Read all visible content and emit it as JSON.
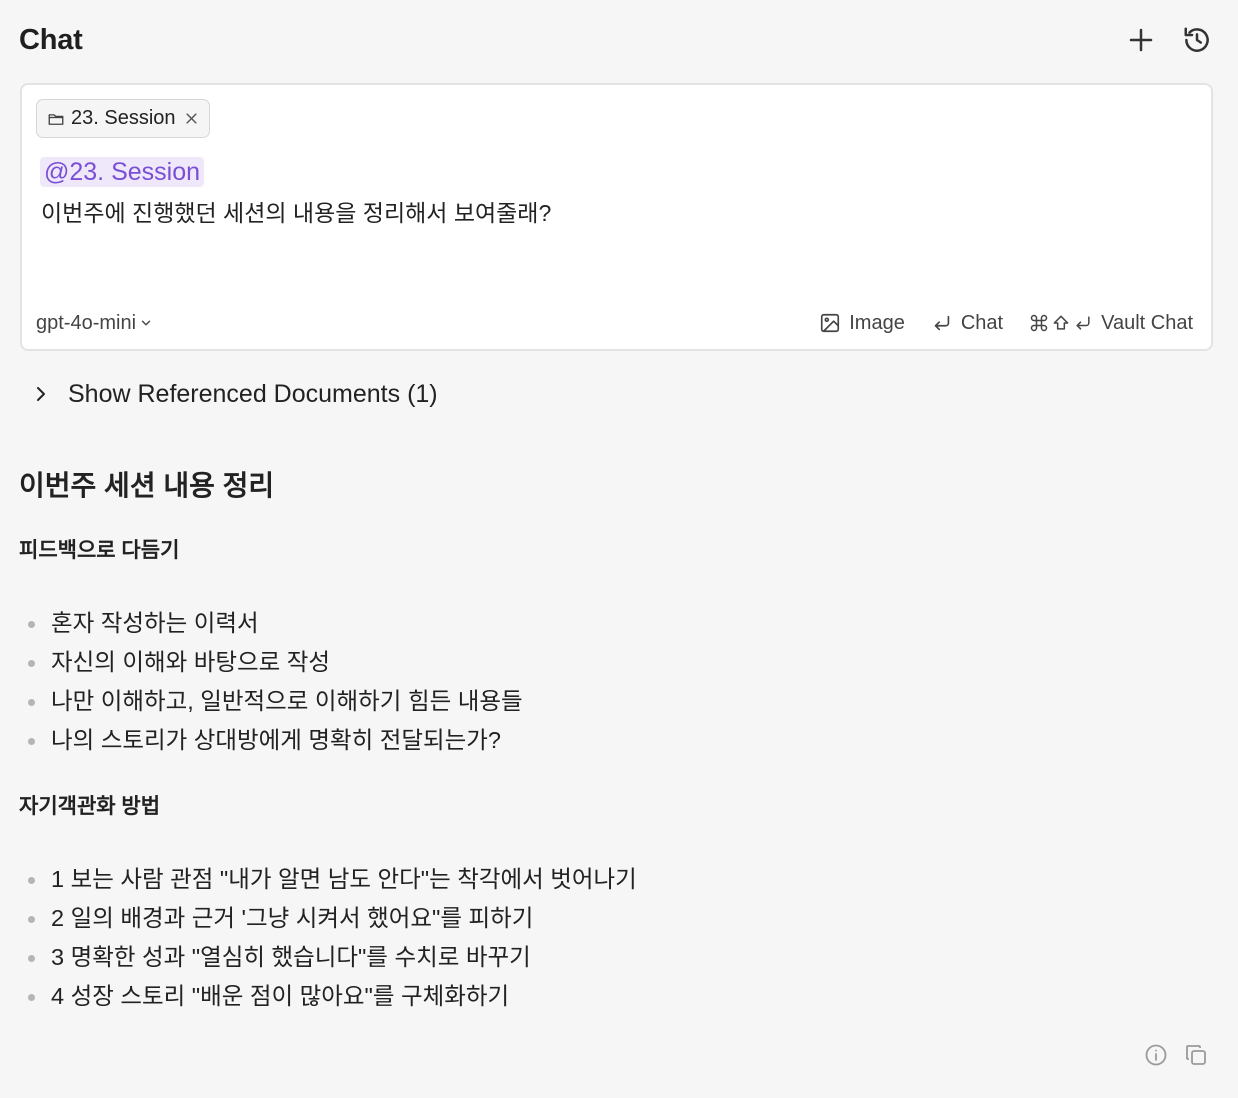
{
  "header": {
    "title": "Chat",
    "new_chat_icon": "plus-icon",
    "history_icon": "history-icon"
  },
  "input": {
    "context_chip": {
      "label": "23. Session",
      "icon": "folder-icon"
    },
    "mention": "@23. Session",
    "prompt": "이번주에 진행했던 세션의 내용을 정리해서 보여줄래?",
    "model": "gpt-4o-mini",
    "actions": {
      "image": "Image",
      "chat": "Chat",
      "vault_chat": "Vault Chat"
    }
  },
  "referenced": {
    "label": "Show Referenced Documents (1)"
  },
  "response": {
    "title": "이번주 세션 내용 정리",
    "sections": [
      {
        "heading": "피드백으로 다듬기",
        "items": [
          "혼자 작성하는 이력서",
          "자신의 이해와 바탕으로 작성",
          "나만 이해하고, 일반적으로 이해하기 힘든 내용들",
          "나의 스토리가 상대방에게 명확히 전달되는가?"
        ]
      },
      {
        "heading": "자기객관화 방법",
        "items": [
          "1 보는 사람 관점 \"내가 알면 남도 안다\"는 착각에서 벗어나기",
          "2 일의 배경과 근거 '그냥 시켜서 했어요\"를 피하기",
          "3 명확한 성과 \"열심히 했습니다\"를 수치로 바꾸기",
          "4 성장 스토리 \"배운 점이 많아요\"를 구체화하기"
        ]
      }
    ]
  },
  "colors": {
    "background": "#f6f6f6",
    "card": "#ffffff",
    "mention_bg": "#efe8fb",
    "mention_text": "#7a4fd6"
  }
}
